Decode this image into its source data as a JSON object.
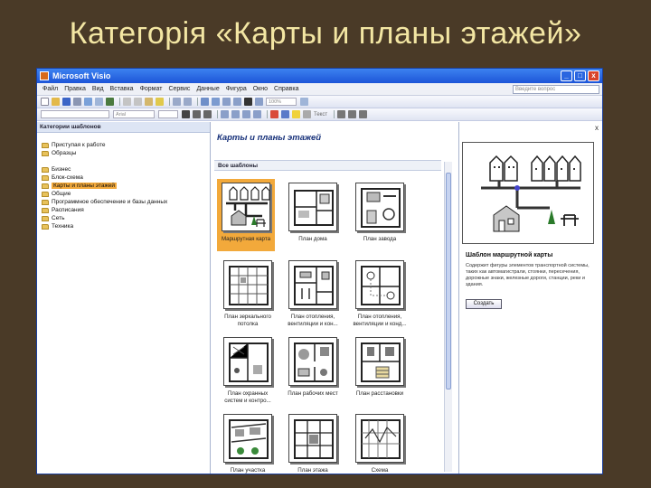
{
  "slide": {
    "title": "Категорія «Карты и планы этажей»"
  },
  "window": {
    "title": "Microsoft Visio",
    "min": "_",
    "max": "□",
    "close": "x"
  },
  "menu": {
    "items": [
      "Файл",
      "Правка",
      "Вид",
      "Вставка",
      "Формат",
      "Сервис",
      "Данные",
      "Фигура",
      "Окно",
      "Справка"
    ],
    "help_placeholder": "Введите вопрос"
  },
  "toolbar": {
    "zoom": "100%",
    "font": "Arial",
    "text_button": "Текст"
  },
  "left_pane": {
    "header": "Категории шаблонов",
    "group1": [
      "Приступая к работе",
      "Образцы"
    ],
    "group2": [
      "Бизнес",
      "Блок-схема",
      "Карты и планы этажей",
      "Общие",
      "Программное обеспечение и базы данных",
      "Расписания",
      "Сеть",
      "Техника"
    ]
  },
  "middle_pane": {
    "heading": "Карты и планы этажей",
    "subheading": "Все шаблоны",
    "templates": [
      "Маршрутная карта",
      "План дома",
      "План завода",
      "План зеркального потолка",
      "План отопления, вентиляции и кон...",
      "План отопления, вентиляции и конд...",
      "План охранных систем и контро...",
      "План рабочих мест",
      "План расстановки",
      "План участка",
      "План этажа",
      "Схема"
    ]
  },
  "right_pane": {
    "close": "x",
    "title": "Шаблон маршрутной карты",
    "description": "Содержит фигуры элементов транспортной системы, таких как автомагистрали, стоянки, пересечения, дорожные знаки, железные дороги, станции, реки и здания.",
    "create_button": "Создать"
  },
  "colors": {
    "background": "#4a3a27",
    "title": "#f3e6a3",
    "selection": "#f2a93b",
    "titlebar": "#1d55d8"
  }
}
